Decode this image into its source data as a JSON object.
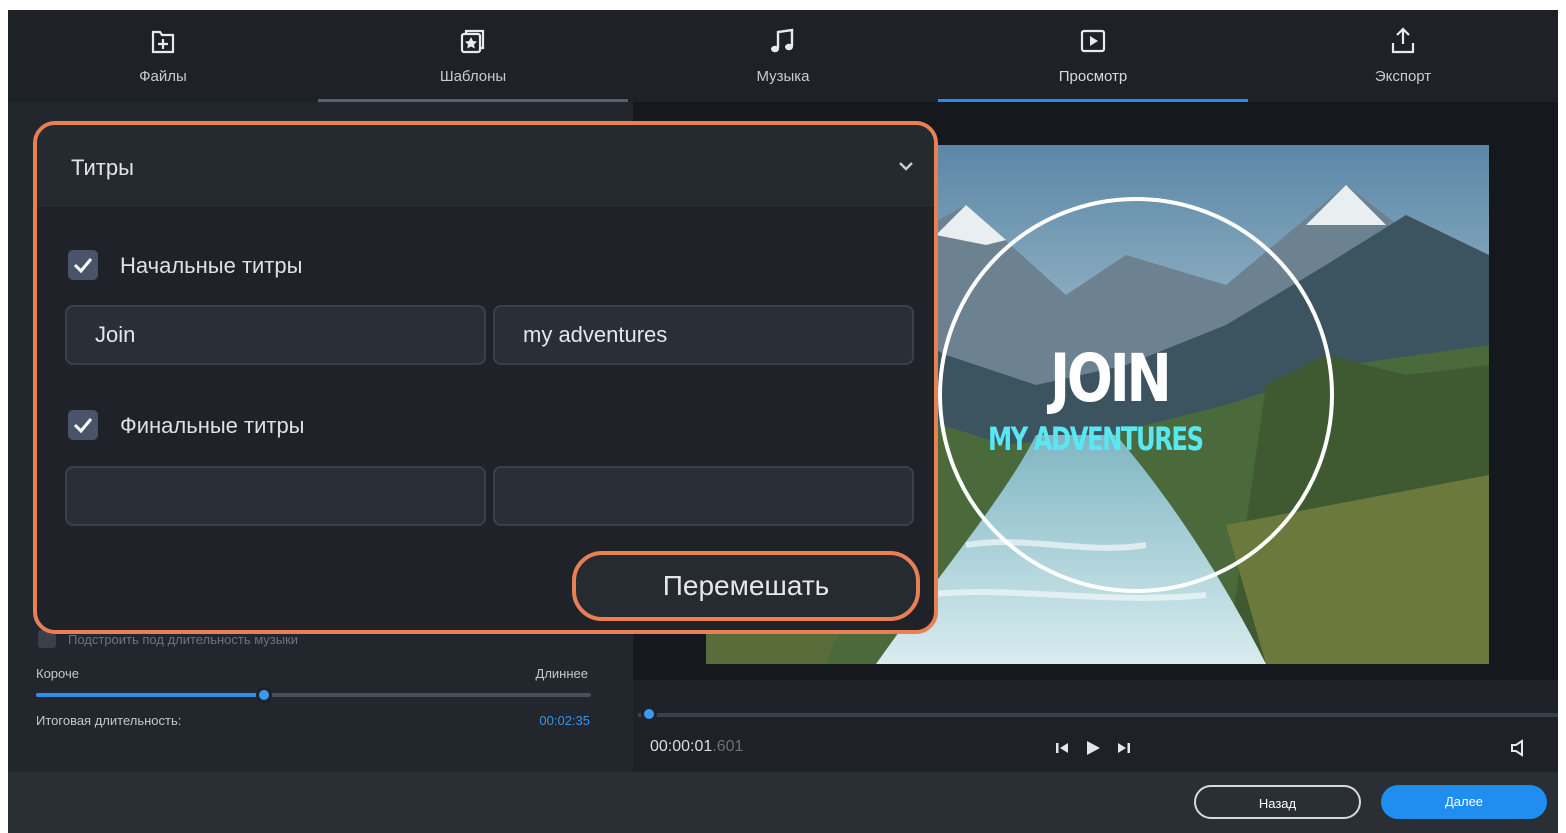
{
  "nav": {
    "tabs": [
      {
        "label": "Файлы",
        "icon": "add-file-icon"
      },
      {
        "label": "Шаблоны",
        "icon": "templates-icon"
      },
      {
        "label": "Музыка",
        "icon": "music-note-icon"
      },
      {
        "label": "Просмотр",
        "icon": "play-preview-icon"
      },
      {
        "label": "Экспорт",
        "icon": "export-icon"
      }
    ],
    "active_tab": "Просмотр",
    "accent_color": "#1f8ef0"
  },
  "titles_panel": {
    "header": "Титры",
    "opening": {
      "label": "Начальные титры",
      "checked": true,
      "field1_value": "Join",
      "field2_value": "my adventures"
    },
    "closing": {
      "label": "Финальные титры",
      "checked": true,
      "field1_value": "",
      "field2_value": ""
    },
    "shuffle_label": "Перемешать"
  },
  "settings": {
    "fit_to_music": "Подстроить под длительность музыки",
    "shorter": "Короче",
    "longer": "Длиннее",
    "duration_slider_fraction": 0.41,
    "total_label": "Итоговая длительность:",
    "total_value": "00:02:35"
  },
  "preview": {
    "title_main": "JOIN",
    "title_sub": "MY ADVENTURES"
  },
  "player": {
    "timecode": "00:00:01",
    "timecode_ms": ".601",
    "position_fraction": 0.01
  },
  "footer": {
    "back_label": "Назад",
    "next_label": "Далее"
  },
  "highlight_color": "#e98055"
}
